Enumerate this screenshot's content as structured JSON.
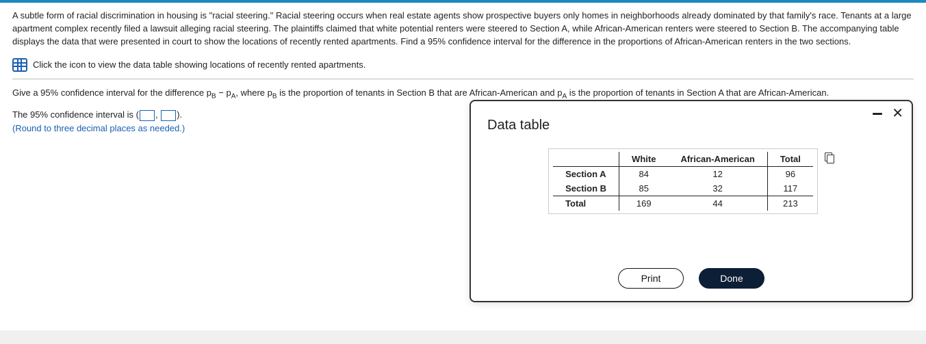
{
  "problem": {
    "paragraph": "A subtle form of racial discrimination in housing is \"racial steering.\" Racial steering occurs when real estate agents show prospective buyers only homes in neighborhoods already dominated by that family's race. Tenants at a large apartment complex recently filed a lawsuit alleging racial steering. The plaintiffs claimed that white potential renters were steered to Section A, while African-American renters were steered to Section B. The accompanying table displays the data that were presented in court to show the locations of recently rented apartments. Find a 95% confidence interval for the difference in the proportions of African-American renters in the two sections.",
    "icon_text": "Click the icon to view the data table showing locations of recently rented apartments.",
    "question_prefix": "Give a 95% confidence interval for the difference p",
    "question_middle_1": " − p",
    "question_middle_2": ", where p",
    "question_middle_3": " is the proportion of tenants in Section B that are African-American and p",
    "question_suffix": " is the proportion of tenants in Section A that are African-American.",
    "sub_B": "B",
    "sub_A": "A",
    "answer_line_prefix": "The 95% confidence interval is (",
    "answer_line_comma": ", ",
    "answer_line_suffix": ").",
    "hint": "(Round to three decimal places as needed.)"
  },
  "modal": {
    "title": "Data table",
    "print_label": "Print",
    "done_label": "Done"
  },
  "table": {
    "headers": {
      "blank": "",
      "c1": "White",
      "c2": "African-American",
      "c3": "Total"
    },
    "rows": [
      {
        "label": "Section A",
        "white": "84",
        "aa": "12",
        "total": "96"
      },
      {
        "label": "Section B",
        "white": "85",
        "aa": "32",
        "total": "117"
      },
      {
        "label": "Total",
        "white": "169",
        "aa": "44",
        "total": "213"
      }
    ]
  },
  "chart_data": {
    "type": "table",
    "title": "Data table",
    "columns": [
      "",
      "White",
      "African-American",
      "Total"
    ],
    "rows": [
      [
        "Section A",
        84,
        12,
        96
      ],
      [
        "Section B",
        85,
        32,
        117
      ],
      [
        "Total",
        169,
        44,
        213
      ]
    ]
  }
}
